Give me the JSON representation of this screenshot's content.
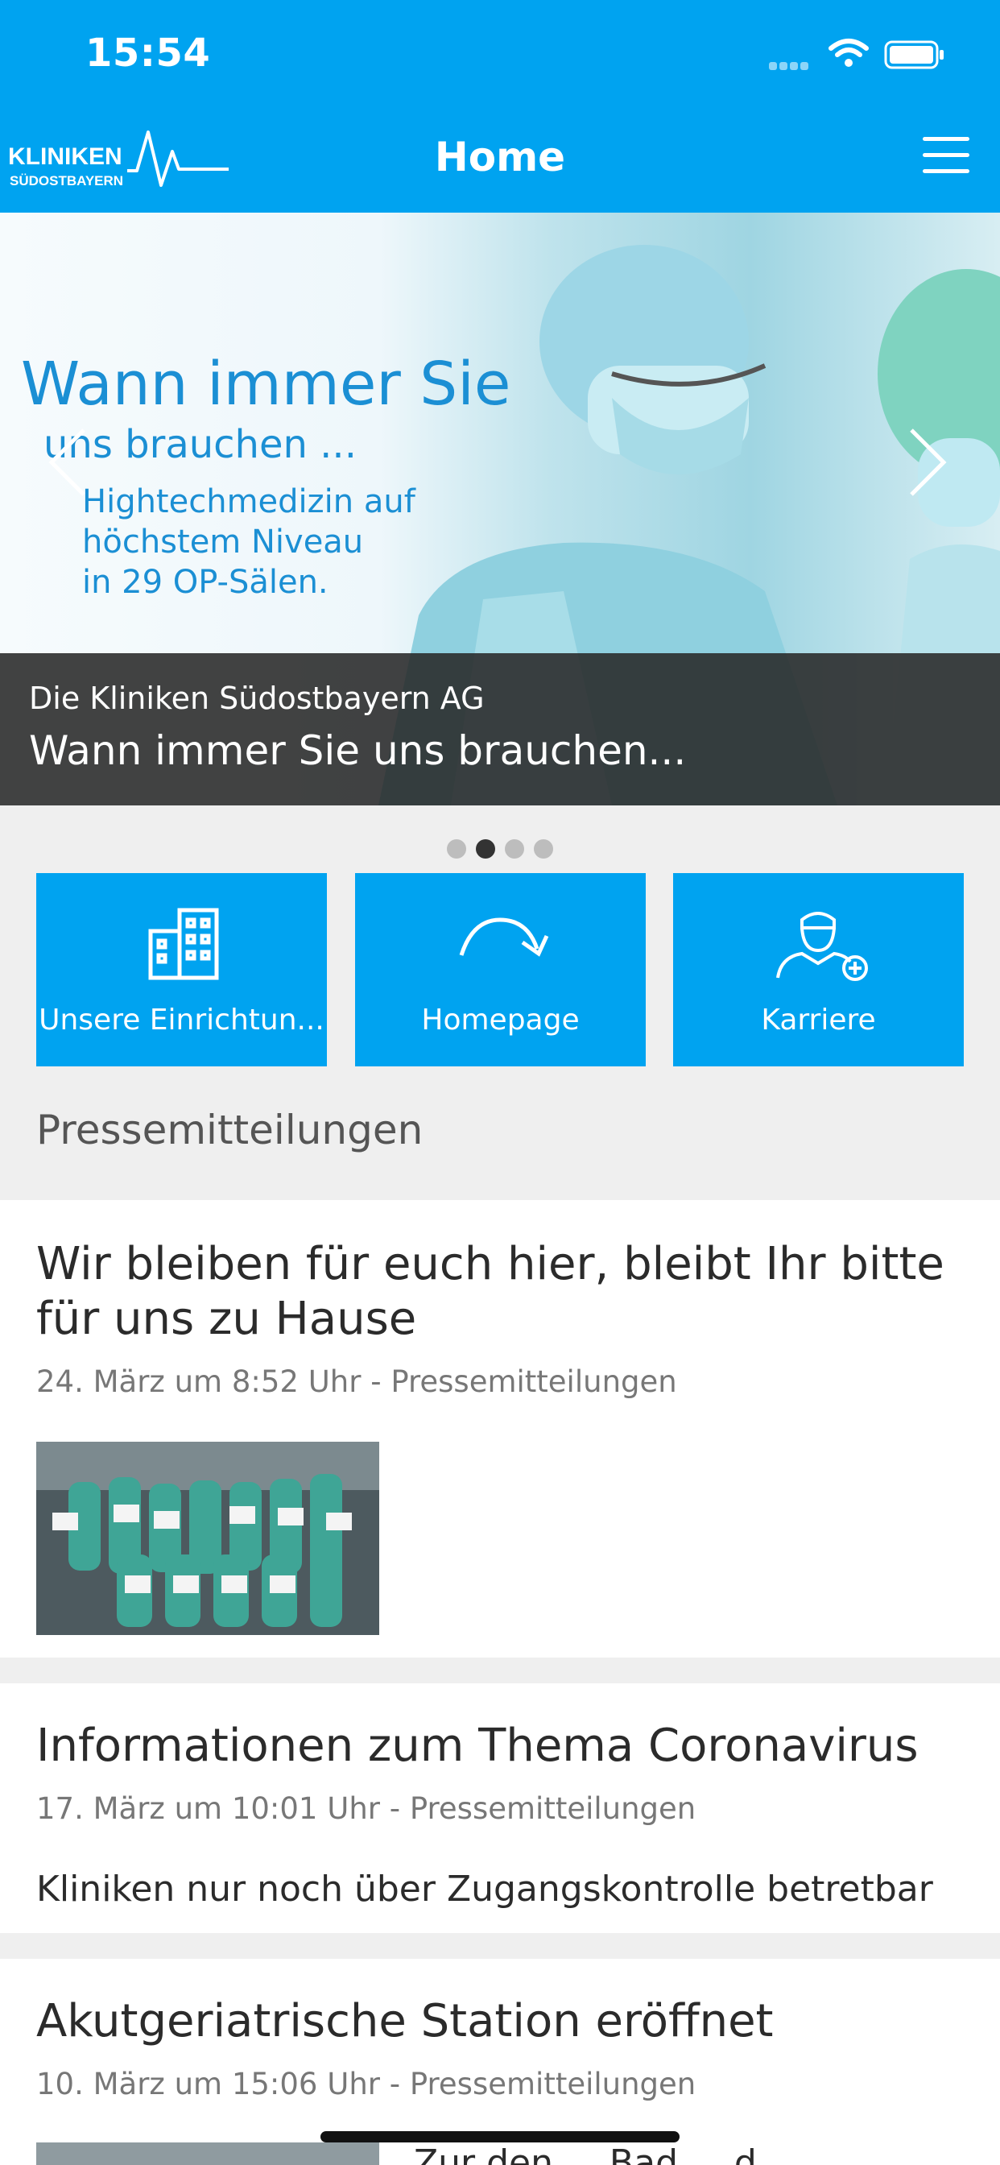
{
  "status_bar": {
    "time": "15:54"
  },
  "header": {
    "logo_line1": "KLINIKEN",
    "logo_line2": "SÜDOSTBAYERN",
    "title": "Home"
  },
  "carousel": {
    "slide_headline": "Wann immer Sie",
    "slide_subline": "uns brauchen ...",
    "slide_body_1": "Hightechmedizin auf",
    "slide_body_2": "höchstem Niveau",
    "slide_body_3": "in 29 OP-Sälen.",
    "caption_subtitle": "Die Kliniken Südostbayern AG",
    "caption_title": "Wann immer Sie uns brauchen...",
    "page_count": 4,
    "active_page": 2
  },
  "tiles": [
    {
      "label": "Unsere Einrichtun...",
      "icon": "building-icon"
    },
    {
      "label": "Homepage",
      "icon": "redo-arrow-icon"
    },
    {
      "label": "Karriere",
      "icon": "doctor-add-icon"
    }
  ],
  "news": {
    "section_title": "Pressemitteilungen",
    "items": [
      {
        "title": "Wir bleiben für euch hier, bleibt Ihr bitte für uns zu Hause",
        "meta": "24. März um 8:52 Uhr - Pressemitteilungen"
      },
      {
        "title": "Informationen zum Thema Coronavirus",
        "meta": "17. März um 10:01 Uhr - Pressemitteilungen",
        "excerpt": "Kliniken nur noch über Zugangskontrolle betretbar"
      },
      {
        "title": "Akutgeriatrische Station eröffnet",
        "meta": "10. März um 15:06 Uhr - Pressemitteilungen",
        "excerpt": "Zur den ... Bad ... d"
      }
    ]
  },
  "colors": {
    "brand_blue": "#00a3f0",
    "text_dark": "#2b2b2b",
    "meta_gray": "#777777"
  }
}
